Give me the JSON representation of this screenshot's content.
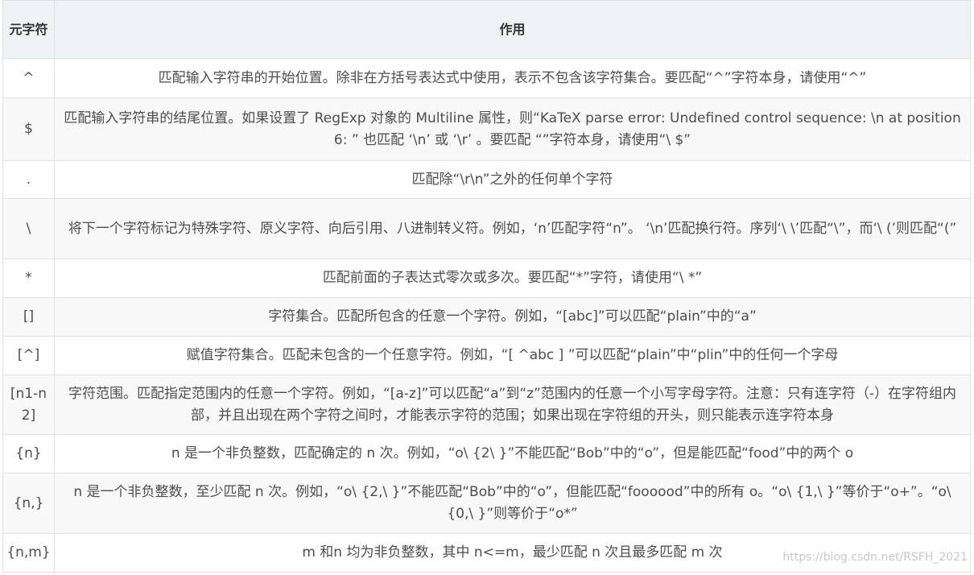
{
  "table": {
    "header": {
      "meta_char": "元字符",
      "effect": "作用"
    },
    "rows": [
      {
        "meta": "^",
        "desc": "匹配输入字符串的开始位置。除非在方括号表达式中使用，表示不包含该字符集合。要匹配“^”字符本身，请使用“^”"
      },
      {
        "meta": "$",
        "desc": "匹配输入字符串的结尾位置。如果设置了 RegExp 对象的 Multiline 属性，则“KaTeX parse error: Undefined control sequence: \\n at position 6: ” 也匹配 ‘\\n’ 或 ‘\\r’ 。要匹配 “”字符本身，请使用“\\ $”"
      },
      {
        "meta": ".",
        "desc": "匹配除“\\r\\n”之外的任何单个字符"
      },
      {
        "meta": "\\",
        "desc": "将下一个字符标记为特殊字符、原义字符、向后引用、八进制转义符。例如，‘n’匹配字符“n”。 ‘\\n’匹配换行符。序列‘\\ \\’匹配“\\”，而‘\\ (’则匹配“(”"
      },
      {
        "meta": "*",
        "desc": "匹配前面的子表达式零次或多次。要匹配“*”字符，请使用“\\ *”"
      },
      {
        "meta": "[]",
        "desc": "字符集合。匹配所包含的任意一个字符。例如，“[abc]”可以匹配“plain”中的“a”"
      },
      {
        "meta": "[^]",
        "desc": "赋值字符集合。匹配未包含的一个任意字符。例如，“[ ^abc ] ”可以匹配“plain”中“plin”中的任何一个字母"
      },
      {
        "meta": "[n1-n2]",
        "desc": "字符范围。匹配指定范围内的任意一个字符。例如，“[a-z]”可以匹配“a”到“z”范围内的任意一个小写字母字符。注意：只有连字符（-）在字符组内部，并且出现在两个字符之间时，才能表示字符的范围；如果出现在字符组的开头，则只能表示连字符本身"
      },
      {
        "meta": "{n}",
        "desc": "n 是一个非负整数，匹配确定的 n 次。例如，“o\\ {2\\ }”不能匹配“Bob”中的“o”，但是能匹配“food”中的两个 o"
      },
      {
        "meta": "{n,}",
        "desc": "n 是一个非负整数，至少匹配 n 次。例如，“o\\ {2,\\ }”不能匹配“Bob”中的“o”，但能匹配“foooood”中的所有 o。“o\\ {1,\\ }”等价于“o+”。“o\\ {0,\\ }”则等价于“o*”"
      },
      {
        "meta": "{n,m}",
        "desc": "m 和n 均为非负整数，其中 n<=m，最少匹配 n 次且最多匹配 m 次"
      }
    ]
  },
  "watermark": "https://blog.csdn.net/RSFH_2021"
}
